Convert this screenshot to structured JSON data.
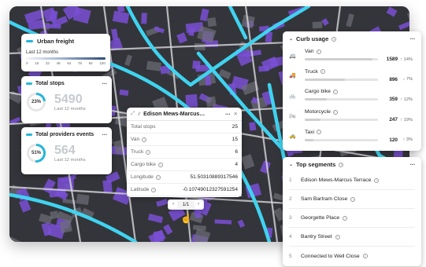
{
  "legend": {
    "title": "Urban freight",
    "subtitle": "Last 12 months",
    "ticks": [
      "0",
      "16",
      "32",
      "48",
      "64",
      "78",
      "94",
      "100"
    ]
  },
  "total_stops": {
    "title": "Total stops",
    "percent": "23%",
    "percent_value": 0.23,
    "value": "5490",
    "caption": "Last 12 months"
  },
  "total_providers": {
    "title": "Total providers events",
    "percent": "51%",
    "percent_value": 0.51,
    "value": "564",
    "caption": "Last 12 months"
  },
  "popup": {
    "title": "Edison Mews-Marcus…",
    "rows": [
      {
        "label": "Total stops",
        "value": "25",
        "info": false
      },
      {
        "label": "Van",
        "value": "15",
        "info": true
      },
      {
        "label": "Truck",
        "value": "6",
        "info": true
      },
      {
        "label": "Cargo bike",
        "value": "4",
        "info": true
      },
      {
        "label": "Longitude",
        "value": "51.50310889317546",
        "info": true
      },
      {
        "label": "Latitude",
        "value": "-0.10749012327591254",
        "info": true
      }
    ],
    "pager": {
      "label": "1/1",
      "prev": "‹",
      "next": "›"
    }
  },
  "curb_usage": {
    "title": "Curb usage",
    "more": "···",
    "items": [
      {
        "label": "Van",
        "value": "1589",
        "change": "↑ 14%",
        "fill": 0.92,
        "icon": "van-icon"
      },
      {
        "label": "Truck",
        "value": "896",
        "change": "↓ 7%",
        "fill": 0.55,
        "icon": "truck-icon"
      },
      {
        "label": "Cargo bike",
        "value": "359",
        "change": "↑ 12%",
        "fill": 0.3,
        "icon": "cargo-bike-icon"
      },
      {
        "label": "Motorcycle",
        "value": "247",
        "change": "↑ 19%",
        "fill": 0.22,
        "icon": "motorcycle-icon"
      },
      {
        "label": "Taxi",
        "value": "120",
        "change": "↑ 3%",
        "fill": 0.12,
        "icon": "taxi-icon"
      }
    ]
  },
  "top_segments": {
    "title": "Top segments",
    "more": "···",
    "items": [
      {
        "rank": "1",
        "name": "Edison Mews-Marcus Terrace"
      },
      {
        "rank": "2",
        "name": "Sam Bartram Close"
      },
      {
        "rank": "3",
        "name": "Georgette Place"
      },
      {
        "rank": "4",
        "name": "Bantry Street"
      },
      {
        "rank": "5",
        "name": "Connected to Well Close"
      }
    ]
  },
  "colors": {
    "accent": "#23b7d9",
    "buildings": "#7a4fd6",
    "road": "#3fd3f0"
  }
}
